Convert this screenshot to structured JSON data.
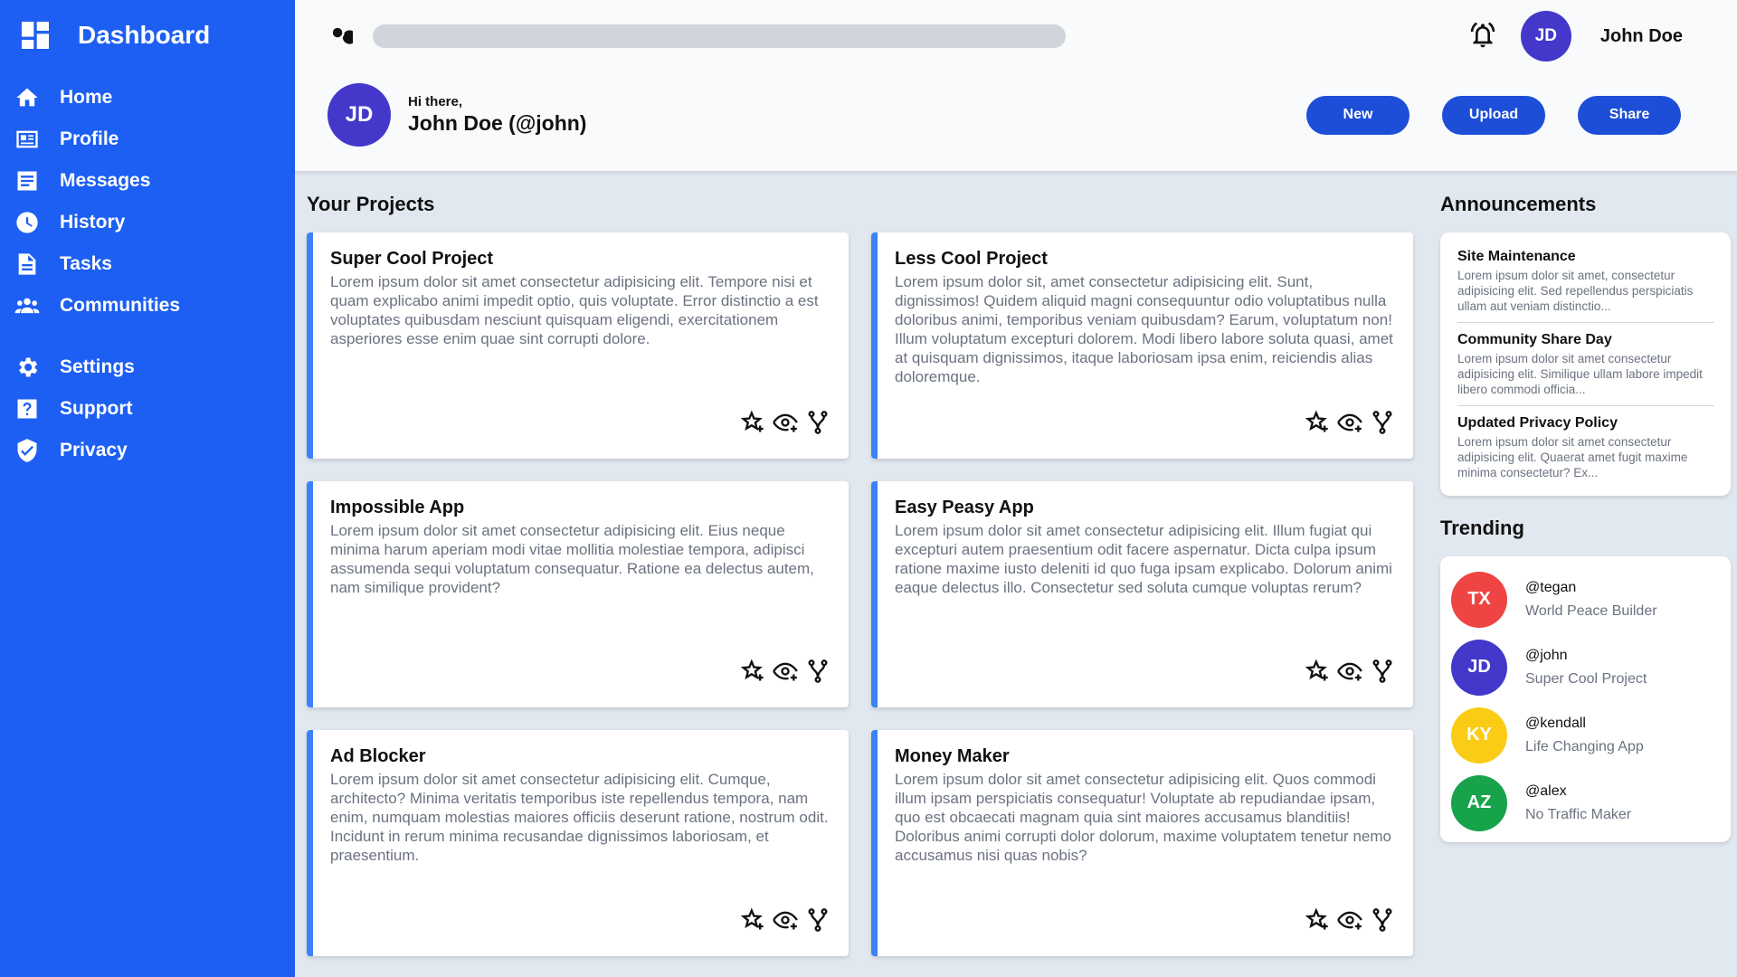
{
  "sidebar": {
    "brand": "Dashboard",
    "items": [
      {
        "label": "Home",
        "icon": "home-icon"
      },
      {
        "label": "Profile",
        "icon": "id-card-icon"
      },
      {
        "label": "Messages",
        "icon": "message-icon"
      },
      {
        "label": "History",
        "icon": "clock-icon"
      },
      {
        "label": "Tasks",
        "icon": "document-icon"
      },
      {
        "label": "Communities",
        "icon": "group-icon"
      },
      {
        "label": "Settings",
        "icon": "gear-icon"
      },
      {
        "label": "Support",
        "icon": "help-icon"
      },
      {
        "label": "Privacy",
        "icon": "shield-icon"
      }
    ]
  },
  "header": {
    "search_placeholder": "",
    "user_initials": "JD",
    "user_name": "John Doe",
    "greeting_small": "Hi there,",
    "greeting_big": "John Doe (@john)",
    "buttons": {
      "new": "New",
      "upload": "Upload",
      "share": "Share"
    }
  },
  "projects": {
    "title": "Your Projects",
    "cards": [
      {
        "title": "Super Cool Project",
        "desc": "Lorem ipsum dolor sit amet consectetur adipisicing elit. Tempore nisi et quam explicabo animi impedit optio, quis voluptate. Error distinctio a est voluptates quibusdam nesciunt quisquam eligendi, exercitationem asperiores esse enim quae sint corrupti dolore."
      },
      {
        "title": "Less Cool Project",
        "desc": "Lorem ipsum dolor sit, amet consectetur adipisicing elit. Sunt, dignissimos! Quidem aliquid magni consequuntur odio voluptatibus nulla doloribus animi, temporibus veniam quibusdam? Earum, voluptatum non! Illum voluptatum excepturi dolorem. Modi libero labore soluta quasi, amet at quisquam dignissimos, itaque laboriosam ipsa enim, reiciendis alias doloremque."
      },
      {
        "title": "Impossible App",
        "desc": "Lorem ipsum dolor sit amet consectetur adipisicing elit. Eius neque minima harum aperiam modi vitae mollitia molestiae tempora, adipisci assumenda sequi voluptatum consequatur. Ratione ea delectus autem, nam similique provident?"
      },
      {
        "title": "Easy Peasy App",
        "desc": "Lorem ipsum dolor sit amet consectetur adipisicing elit. Illum fugiat qui excepturi autem praesentium odit facere aspernatur. Dicta culpa ipsum ratione maxime iusto deleniti id quo fuga ipsam explicabo. Dolorum animi eaque delectus illo. Consectetur sed soluta cumque voluptas rerum?"
      },
      {
        "title": "Ad Blocker",
        "desc": "Lorem ipsum dolor sit amet consectetur adipisicing elit. Cumque, architecto? Minima veritatis temporibus iste repellendus tempora, nam enim, numquam molestias maiores officiis deserunt ratione, nostrum odit. Incidunt in rerum minima recusandae dignissimos laboriosam, et praesentium."
      },
      {
        "title": "Money Maker",
        "desc": "Lorem ipsum dolor sit amet consectetur adipisicing elit. Quos commodi illum ipsam perspiciatis consequatur! Voluptate ab repudiandae ipsam, quo est obcaecati magnam quia sint maiores accusamus blanditiis! Doloribus animi corrupti dolor dolorum, maxime voluptatem tenetur nemo accusamus nisi quas nobis?"
      }
    ]
  },
  "announcements": {
    "title": "Announcements",
    "items": [
      {
        "title": "Site Maintenance",
        "body": "Lorem ipsum dolor sit amet, consectetur adipisicing elit. Sed repellendus perspiciatis ullam aut veniam distinctio..."
      },
      {
        "title": "Community Share Day",
        "body": "Lorem ipsum dolor sit amet consectetur adipisicing elit. Similique ullam labore impedit libero commodi officia..."
      },
      {
        "title": "Updated Privacy Policy",
        "body": "Lorem ipsum dolor sit amet consectetur adipisicing elit. Quaerat amet fugit maxime minima consectetur? Ex..."
      }
    ]
  },
  "trending": {
    "title": "Trending",
    "items": [
      {
        "initials": "TX",
        "handle": "@tegan",
        "sub": "World Peace Builder",
        "color": "#ef4444"
      },
      {
        "initials": "JD",
        "handle": "@john",
        "sub": "Super Cool Project",
        "color": "#4338ca"
      },
      {
        "initials": "KY",
        "handle": "@kendall",
        "sub": "Life Changing App",
        "color": "#facc15"
      },
      {
        "initials": "AZ",
        "handle": "@alex",
        "sub": "No Traffic Maker",
        "color": "#16a34a"
      }
    ]
  }
}
